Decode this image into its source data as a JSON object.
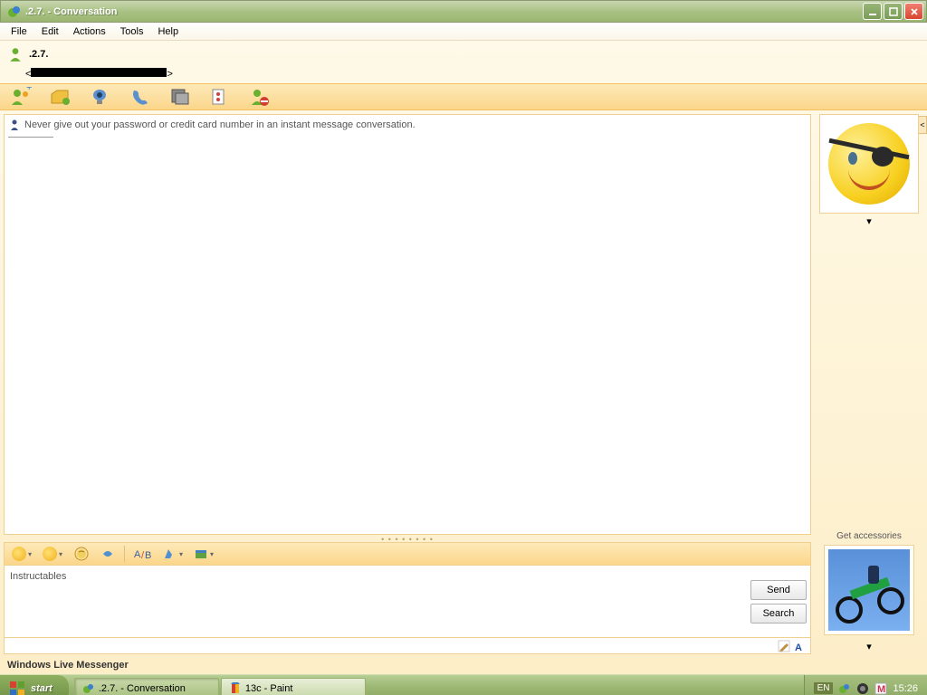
{
  "titlebar": {
    "text": ".2.7.  - Conversation"
  },
  "menubar": [
    "File",
    "Edit",
    "Actions",
    "Tools",
    "Help"
  ],
  "contact": {
    "name": ".2.7."
  },
  "warning": "Never give out your password or credit card number in an instant message conversation.",
  "compose": {
    "text": "Instructables"
  },
  "buttons": {
    "send": "Send",
    "search": "Search"
  },
  "accessories_label": "Get accessories",
  "footer": "Windows Live Messenger",
  "taskbar": {
    "start": "start",
    "items": [
      {
        "label": ".2.7.  - Conversation",
        "active": true
      },
      {
        "label": "13c - Paint",
        "active": false
      }
    ],
    "lang": "EN",
    "clock": "15:26"
  }
}
